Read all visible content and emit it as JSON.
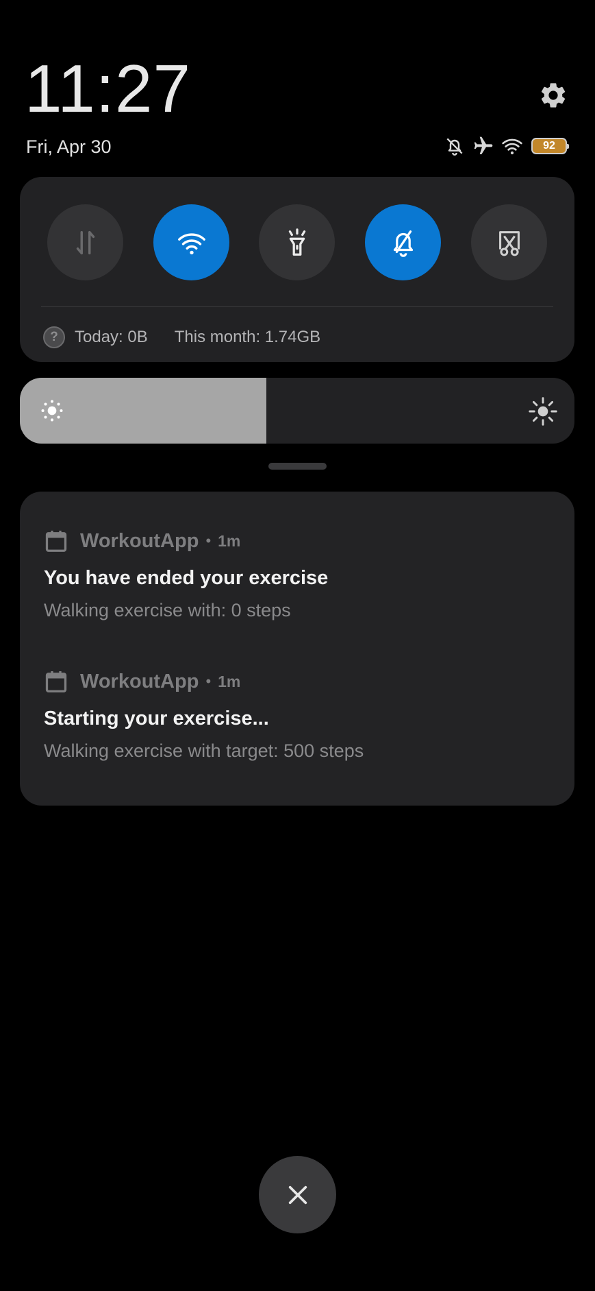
{
  "header": {
    "time": "11:27",
    "date": "Fri, Apr 30"
  },
  "status_bar": {
    "icons": [
      "notifications-muted-icon",
      "airplane-icon",
      "wifi-icon"
    ],
    "battery": "92",
    "battery_color": "#c2872a"
  },
  "quick_toggles": [
    {
      "name": "mobile-data",
      "icon": "data-arrows-icon",
      "active": false
    },
    {
      "name": "wifi",
      "icon": "wifi-icon",
      "active": true
    },
    {
      "name": "flashlight",
      "icon": "flashlight-icon",
      "active": false
    },
    {
      "name": "mute",
      "icon": "bell-off-icon",
      "active": true
    },
    {
      "name": "screenshot",
      "icon": "scissors-icon",
      "active": false
    }
  ],
  "data_usage": {
    "today": "Today: 0B",
    "month": "This month: 1.74GB"
  },
  "brightness": {
    "level": 0.445
  },
  "notifications": [
    {
      "app": "WorkoutApp",
      "time": "1m",
      "title": "You have ended your exercise",
      "body": "Walking exercise with: 0 steps"
    },
    {
      "app": "WorkoutApp",
      "time": "1m",
      "title": "Starting your exercise...",
      "body": "Walking exercise with target: 500 steps"
    }
  ],
  "colors": {
    "accent": "#0a78d2",
    "panel": "#222224",
    "background": "#000000"
  }
}
